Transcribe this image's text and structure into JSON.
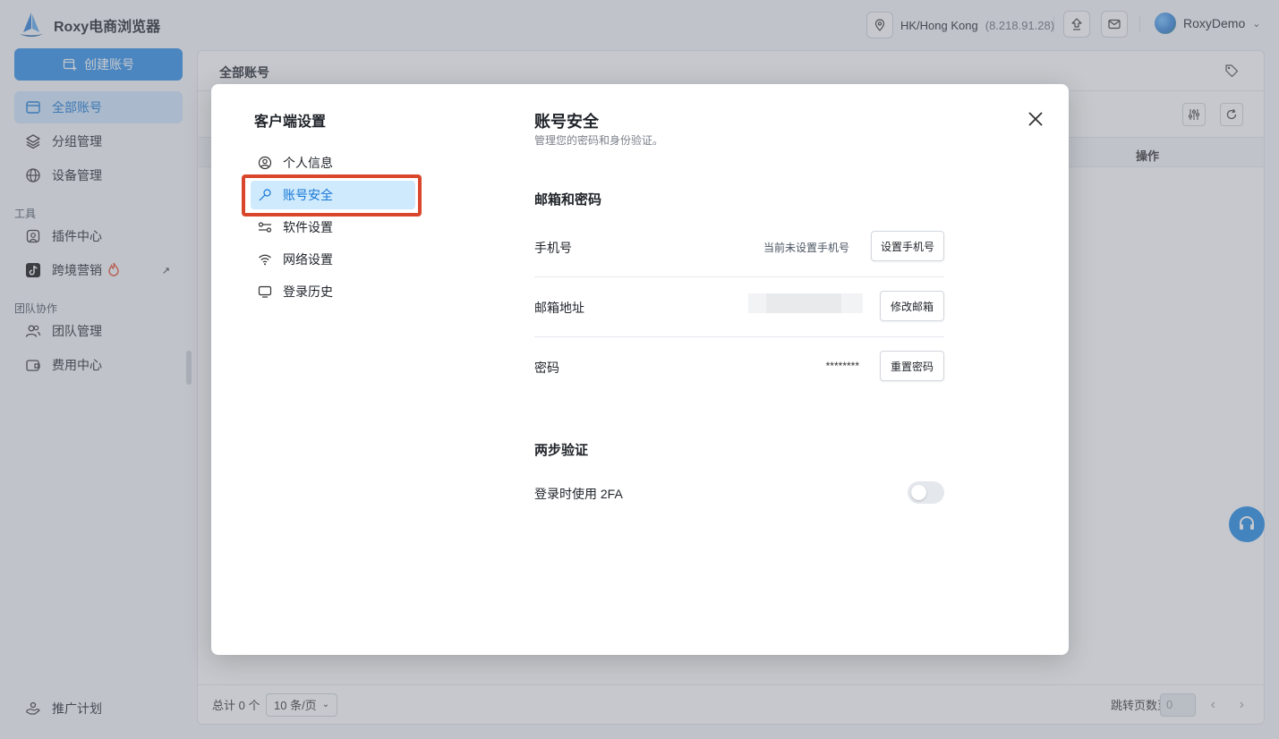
{
  "app": {
    "name": "Roxy电商浏览器",
    "location": "HK/Hong Kong",
    "ip": "(8.218.91.28)",
    "username": "RoxyDemo"
  },
  "sidebar": {
    "create_label": "创建账号",
    "items": [
      {
        "label": "全部账号",
        "icon": "window-icon"
      },
      {
        "label": "分组管理",
        "icon": "layers-icon"
      },
      {
        "label": "设备管理",
        "icon": "globe-icon"
      }
    ],
    "tools_section": "工具",
    "tools": [
      {
        "label": "插件中心",
        "icon": "plugin-icon"
      },
      {
        "label": "跨境营销",
        "icon": "tiktok-icon",
        "badge": "fire-icon"
      }
    ],
    "team_section": "团队协作",
    "team": [
      {
        "label": "团队管理",
        "icon": "team-icon"
      },
      {
        "label": "费用中心",
        "icon": "wallet-icon"
      }
    ],
    "promo": {
      "label": "推广计划",
      "icon": "handshake-icon"
    }
  },
  "main": {
    "title": "全部账号",
    "op_column": "操作",
    "footer": {
      "total": "总计 0 个",
      "page_size": "10 条/页",
      "jump_label": "跳转页数至",
      "jump_value": "0"
    }
  },
  "modal": {
    "heading": "客户端设置",
    "menu": [
      {
        "label": "个人信息",
        "icon": "user-circle-icon"
      },
      {
        "label": "账号安全",
        "icon": "key-icon"
      },
      {
        "label": "软件设置",
        "icon": "sliders-icon"
      },
      {
        "label": "网络设置",
        "icon": "wifi-icon"
      },
      {
        "label": "登录历史",
        "icon": "monitor-icon"
      }
    ],
    "section_title": "账号安全",
    "section_subtitle": "管理您的密码和身份验证。",
    "email_password_group": "邮箱和密码",
    "rows": {
      "phone": {
        "label": "手机号",
        "value": "当前未设置手机号",
        "button": "设置手机号"
      },
      "email": {
        "label": "邮箱地址",
        "value": "",
        "button": "修改邮箱"
      },
      "password": {
        "label": "密码",
        "value": "********",
        "button": "重置密码"
      }
    },
    "two_step_group": "两步验证",
    "twofa": {
      "label": "登录时使用 2FA",
      "enabled": false
    }
  },
  "colors": {
    "accent": "#2b8ee8",
    "active_bg": "#cfe6fb",
    "highlight": "#d9462b"
  }
}
